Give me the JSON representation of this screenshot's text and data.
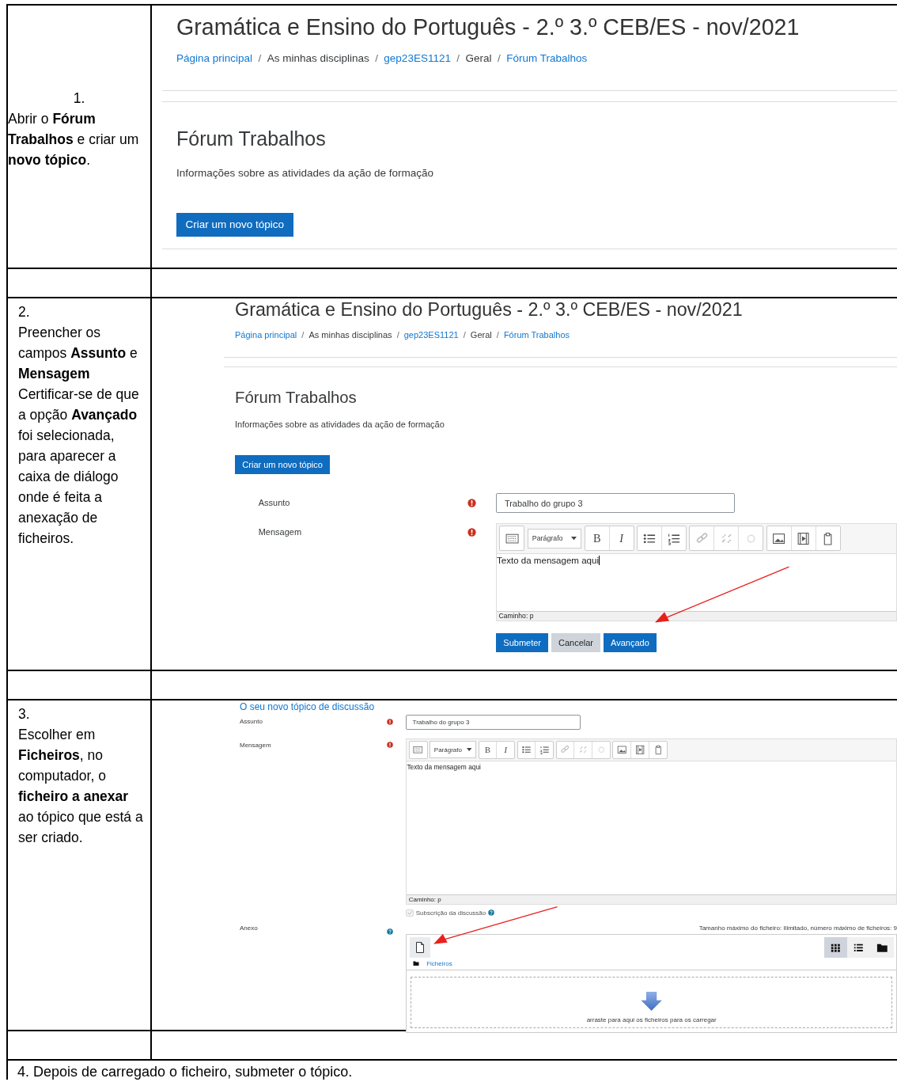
{
  "steps": [
    {
      "kind": "centered",
      "number": "1.",
      "text": "Abrir o **Fórum Trabalhos** e criar um **novo tópico**.",
      "screenshot": {
        "kind": "forum",
        "course_title": "Gramática e Ensino do Português - 2.º 3.º CEB/ES - nov/2021",
        "breadcrumb_separator": "/",
        "breadcrumbs": [
          {
            "label": "Página principal",
            "link": true
          },
          {
            "label": "As minhas disciplinas",
            "link": false
          },
          {
            "label": "gep23ES1121",
            "link": true
          },
          {
            "label": "Geral",
            "link": false
          },
          {
            "label": "Fórum Trabalhos",
            "link": true
          }
        ],
        "forum_title": "Fórum Trabalhos",
        "description": "Informações sobre as atividades da ação de formação",
        "new_topic_button": "Criar um novo tópico"
      }
    },
    {
      "kind": "top",
      "number": "2.",
      "text": "Preencher os campos **Assunto** e **Mensagem** Certificar-se de que a opção **Avançado** foi selecionada, para aparecer a caixa de diálogo onde é feita a anexação de ficheiros.",
      "screenshot": {
        "kind": "forum_with_form",
        "course_title": "Gramática e Ensino do Português - 2.º 3.º CEB/ES - nov/2021",
        "breadcrumb_separator": "/",
        "breadcrumbs": [
          {
            "label": "Página principal",
            "link": true
          },
          {
            "label": "As minhas disciplinas",
            "link": false
          },
          {
            "label": "gep23ES1121",
            "link": true
          },
          {
            "label": "Geral",
            "link": false
          },
          {
            "label": "Fórum Trabalhos",
            "link": true
          }
        ],
        "forum_title": "Fórum Trabalhos",
        "description": "Informações sobre as atividades da ação de formação",
        "new_topic_button": "Criar um novo tópico",
        "form": {
          "fields": [
            {
              "kind": "text",
              "label": "Assunto",
              "required": true,
              "value": "Trabalho do grupo  3"
            },
            {
              "kind": "editor",
              "label": "Mensagem",
              "required": true,
              "format": "Parágrafo",
              "bold": "B",
              "italic": "I",
              "text": "Texto da mensagem aqui",
              "caret": true,
              "path": "Caminho: p"
            }
          ],
          "buttons": [
            {
              "kind": "primary",
              "label": "Submeter",
              "arrow": false
            },
            {
              "kind": "secondary",
              "label": "Cancelar",
              "arrow": false
            },
            {
              "kind": "primary",
              "label": "Avançado",
              "arrow": true
            }
          ]
        }
      }
    },
    {
      "kind": "top",
      "number": "3.",
      "text": "Escolher em **Ficheiros**, no computador, o **ficheiro a anexar** ao tópico que está a ser criado.",
      "screenshot": {
        "kind": "form",
        "section_heading": "O seu novo tópico de discussão",
        "form": {
          "fields": [
            {
              "kind": "text",
              "label": "Assunto",
              "required": true,
              "value": "Trabalho do grupo 3"
            },
            {
              "kind": "editor",
              "label": "Mensagem",
              "required": true,
              "format": "Parágrafo",
              "bold": "B",
              "italic": "I",
              "text": "Texto da mensagem aqui",
              "caret": false,
              "path": "Caminho: p"
            },
            {
              "kind": "checkbox",
              "label": "Subscrição da discussão",
              "checked": true,
              "disabled": true,
              "help": true
            },
            {
              "kind": "filepicker",
              "label": "Anexo",
              "help": true,
              "limits": "Tamanho máximo do ficheiro: Ilimitado, número máximo de ficheiros: 9",
              "add_arrow": true,
              "folder": "Ficheiros",
              "drop_hint": "arraste para aqui os ficheiros para os carregar",
              "view_modes": [
                {
                  "kind": "grid",
                  "selected": true
                },
                {
                  "kind": "list",
                  "selected": false
                },
                {
                  "kind": "tree",
                  "selected": false
                }
              ]
            }
          ]
        }
      }
    }
  ],
  "final_step": "4. Depois de carregado o ficheiro, submeter o tópico."
}
